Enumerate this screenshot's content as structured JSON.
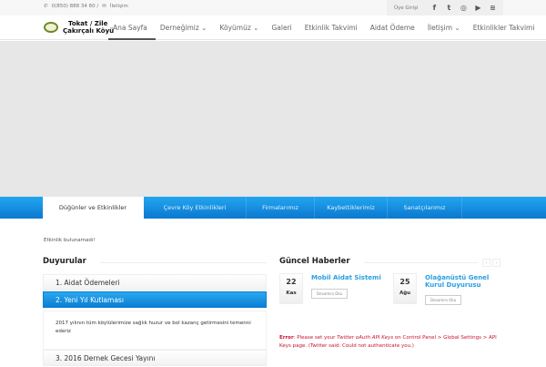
{
  "topbar": {
    "phone": "0(850) 888 34 60 /",
    "contact": "İletişim",
    "login": "Üye Girişi",
    "social": [
      "facebook-icon",
      "twitter-icon",
      "instagram-icon",
      "youtube-icon",
      "rss-icon"
    ]
  },
  "brand": {
    "line1": "Tokat / Zile",
    "line2": "Çakırçalı Köyü"
  },
  "menu": [
    "Ana Sayfa",
    "Derneğimiz ⌄",
    "Köyümüz ⌄",
    "Galeri",
    "Etkinlik Takvimi",
    "Aidat Ödeme",
    "İletişim ⌄",
    "Etkinlikler Takvimi"
  ],
  "tabs": [
    "Düğünler ve Etkinlikler",
    "Çevre Köy Etkinlikleri",
    "Firmalarımız",
    "Kaybettiklerimiz",
    "Sanatçılarımız"
  ],
  "events_empty": "Etkinlik bulunamadı!",
  "announcements": {
    "title": "Duyurular",
    "items": [
      "1. Aidat Ödemeleri",
      "2. Yeni Yıl Kutlaması",
      "3. 2016 Dernek Gecesi Yayını"
    ],
    "open_body": "2017 yılının tüm köylülerimize sağlık huzur ve bol kazanç getirmesini temenni ederiz"
  },
  "news": {
    "title": "Güncel Haberler",
    "prev": "‹",
    "next": "›",
    "items": [
      {
        "day": "22",
        "month": "Kas",
        "title": "Mobil Aidat Sistemi",
        "more": "Devamını Oku"
      },
      {
        "day": "25",
        "month": "Ağu",
        "title": "Olağanüstü Genel Kurul Duyurusu",
        "more": "Devamını Oku"
      }
    ]
  },
  "error": {
    "label": "Error",
    "pre": ": Please set your ",
    "em": "Twitter oAuth API Keys",
    "post": " on Control Panel > Global Settings > API Keys page. (Twitter said: Could not authenticate you.)"
  }
}
